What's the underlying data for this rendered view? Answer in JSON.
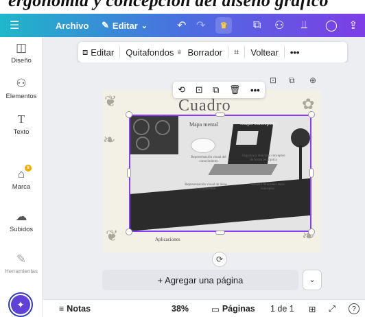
{
  "cropped_heading": "ergonomia y concepción del diseño gráfico",
  "topbar": {
    "menu_icon": "menu-icon",
    "archivo": "Archivo",
    "editar": "Editar",
    "editar_chevron": "chevron-down-icon",
    "undo_icon": "undo-icon",
    "redo_icon": "redo-icon",
    "crown_icon": "crown-icon",
    "icons": [
      "copy-icon",
      "add-person-icon",
      "chart-icon",
      "comment-icon",
      "share-icon"
    ]
  },
  "sidebar": {
    "items": [
      {
        "label": "Diseño",
        "icon": "layout-icon"
      },
      {
        "label": "Elementos",
        "icon": "shapes-icon"
      },
      {
        "label": "Texto",
        "icon": "text-icon"
      },
      {
        "label": "Marca",
        "icon": "brand-icon"
      },
      {
        "label": "Subidos",
        "icon": "upload-icon"
      },
      {
        "label": "Herramientas",
        "icon": "draw-icon"
      }
    ],
    "magic_icon": "magic-sparkle-icon"
  },
  "context_toolbar": {
    "items": [
      "Editar",
      "Quitafondos",
      "Borrador",
      "Voltear",
      "..."
    ],
    "icons": [
      "image-edit-icon",
      "crown-icon",
      "crop-icon",
      "more-icon"
    ]
  },
  "element_toolbar": {
    "icons": [
      "ai-comment-icon",
      "lock-icon",
      "duplicate-icon",
      "delete-icon",
      "more-icon"
    ],
    "more_label": "•••"
  },
  "page_top_icons": [
    "lock-icon",
    "duplicate-icon",
    "add-page-icon"
  ],
  "design": {
    "title": "Cuadro",
    "labels": [
      "Mapa mental",
      "Mapa conceptual"
    ],
    "small_texts": [
      "Representación visual del conocimiento",
      "Organiza y relaciona conceptos de forma jerárquica",
      "Representación visual de ideas y asociaciones",
      "Muestra relaciones entre conceptos"
    ],
    "bottom_label": "Aplicaciones"
  },
  "actions": {
    "add_page": "+ Agregar una página",
    "add_page_dropdown": "chevron-down-icon",
    "rotate_icon": "rotate-icon"
  },
  "bottombar": {
    "notas": "Notas",
    "zoom": "38%",
    "paginas": "Páginas",
    "page_count": "1 de 1",
    "grid_icon": "grid-icon",
    "expand_icon": "expand-icon",
    "help_icon": "help-icon",
    "help": "?"
  },
  "colors": {
    "selection": "#8b3dff",
    "topbar_start": "#1fb6c9",
    "topbar_end": "#7e3de6",
    "crown": "#ffcf3a"
  }
}
